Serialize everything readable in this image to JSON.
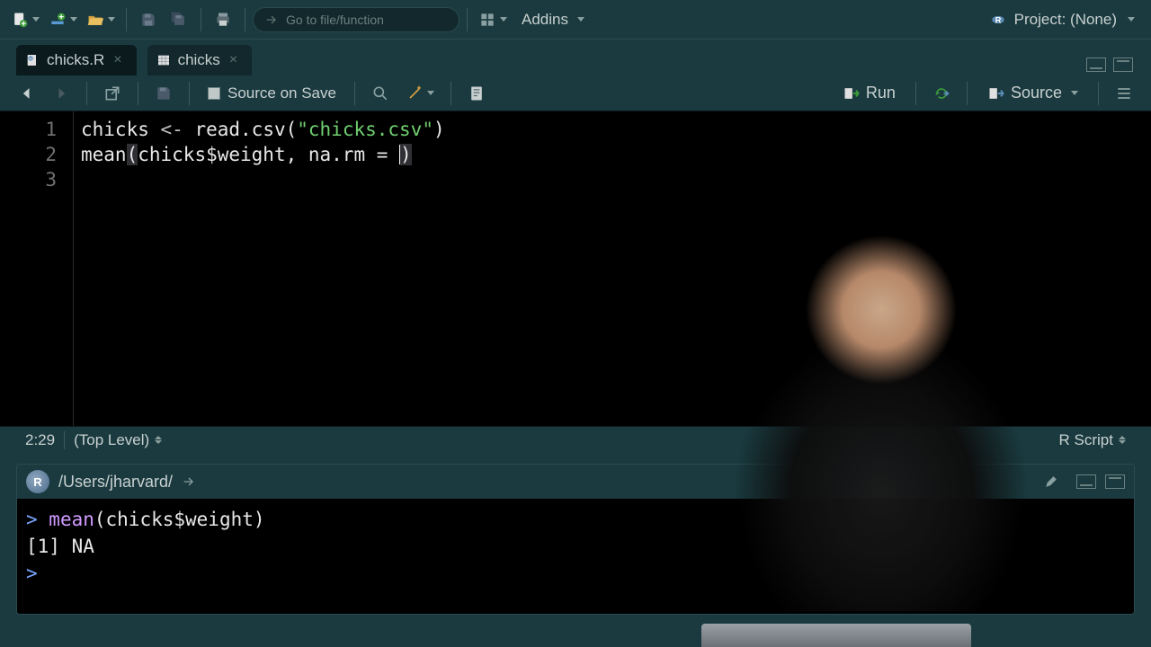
{
  "toolbar": {
    "goto_placeholder": "Go to file/function",
    "addins_label": "Addins",
    "project_label": "Project: (None)"
  },
  "tabs": [
    {
      "label": "chicks.R",
      "icon": "r-file-icon",
      "active": true
    },
    {
      "label": "chicks",
      "icon": "table-icon",
      "active": false
    }
  ],
  "source_toolbar": {
    "source_on_save_label": "Source on Save",
    "run_label": "Run",
    "source_label": "Source"
  },
  "editor": {
    "lines": [
      {
        "num": "1",
        "segments": [
          {
            "t": "chicks ",
            "c": "tok-fn"
          },
          {
            "t": "<-",
            "c": "tok-op"
          },
          {
            "t": " read.csv(",
            "c": "tok-fn"
          },
          {
            "t": "\"chicks.csv\"",
            "c": "tok-str"
          },
          {
            "t": ")",
            "c": "tok-fn"
          }
        ]
      },
      {
        "num": "2",
        "segments": [
          {
            "t": "mean",
            "c": "tok-fn"
          },
          {
            "t": "(",
            "c": "tok-hl"
          },
          {
            "t": "chicks$weight, na.rm = ",
            "c": "tok-fn"
          },
          {
            "cursor": true
          },
          {
            "t": ")",
            "c": "tok-hl"
          }
        ]
      },
      {
        "num": "3",
        "segments": []
      }
    ]
  },
  "status": {
    "cursor_pos": "2:29",
    "scope": "(Top Level)",
    "file_type": "R Script"
  },
  "console": {
    "working_dir": "/Users/jharvard/",
    "history": [
      {
        "type": "input",
        "segments": [
          {
            "t": "> ",
            "c": "prompt"
          },
          {
            "t": "mean",
            "c": "console-fn"
          },
          {
            "t": "(chicks$weight)",
            "c": "console-txt"
          }
        ]
      },
      {
        "type": "output",
        "text": "[1] NA"
      },
      {
        "type": "input",
        "segments": [
          {
            "t": "> ",
            "c": "prompt"
          }
        ]
      }
    ]
  }
}
